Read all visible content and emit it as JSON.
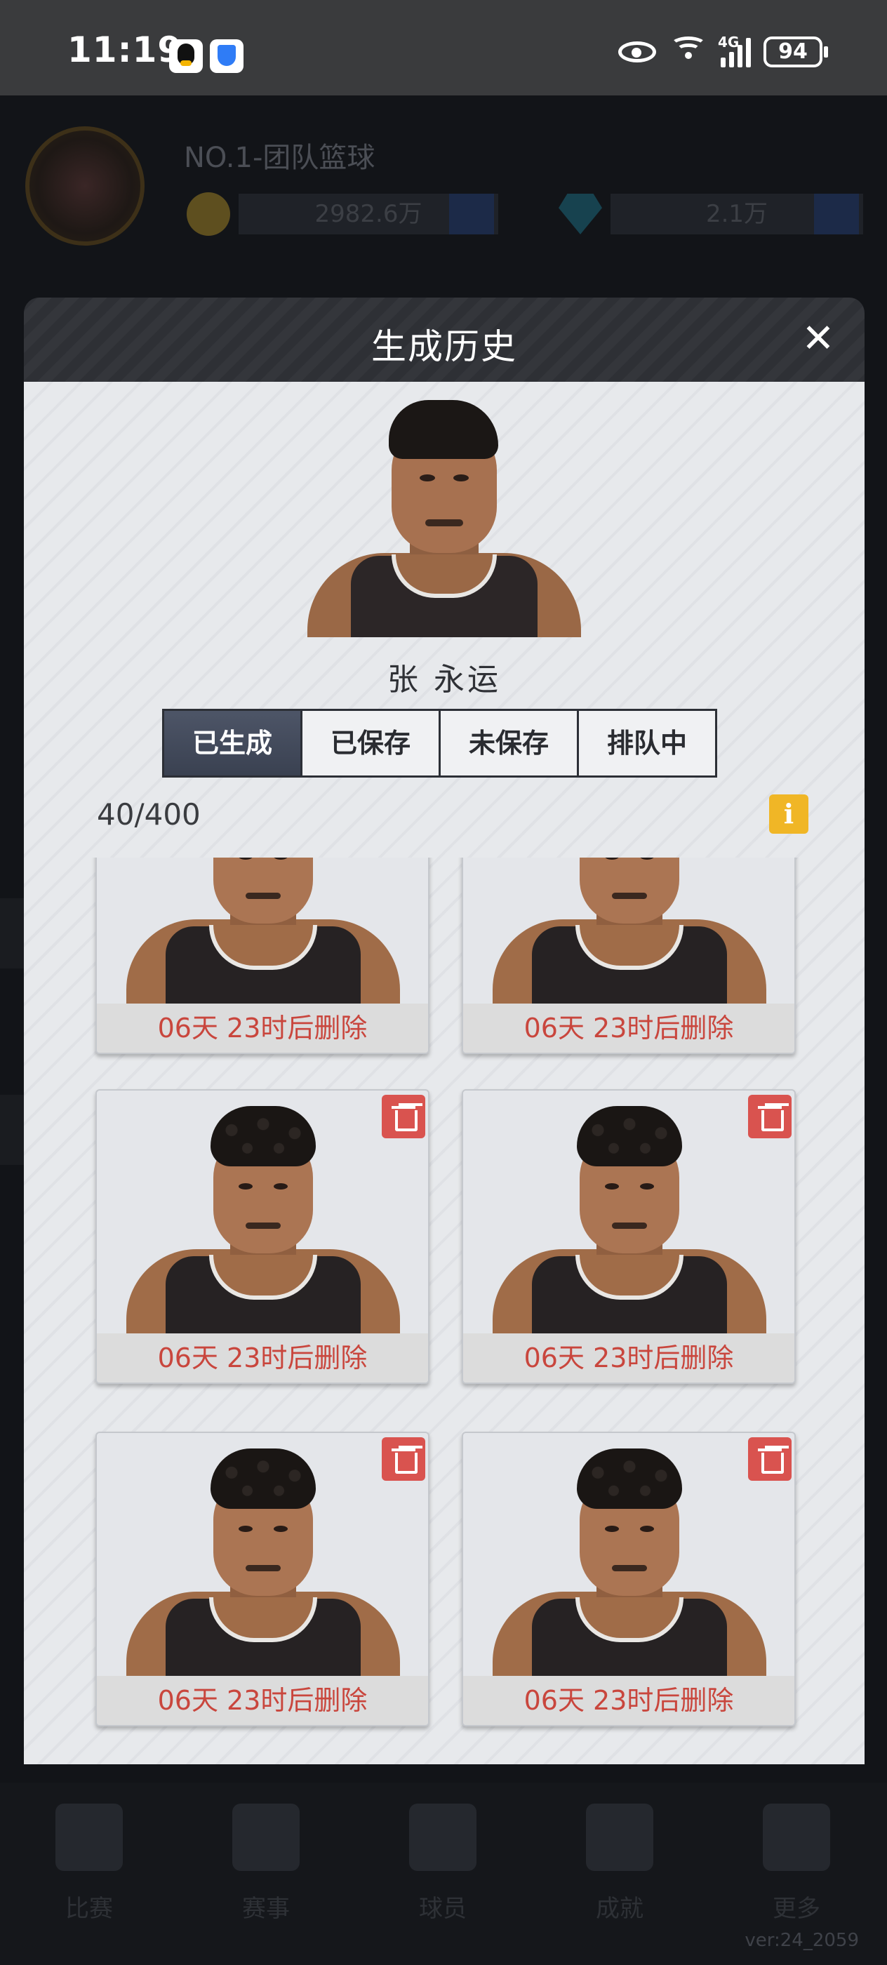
{
  "status_bar": {
    "time": "11:19",
    "battery": "94",
    "network": "4G",
    "icons": [
      "qq-icon",
      "shield-icon",
      "eye-icon",
      "wifi-icon",
      "signal-icon",
      "battery-icon"
    ]
  },
  "background": {
    "team_name": "NO.1-团队篮球",
    "coins": "2982.6万",
    "gems": "2.1万",
    "nav": [
      "比赛",
      "赛事",
      "球员",
      "成就",
      "更多"
    ],
    "version": "ver:24_2059"
  },
  "modal": {
    "title": "生成历史",
    "close_icon": "close-icon",
    "player_name": "张 永运",
    "tabs": [
      {
        "label": "已生成",
        "active": true
      },
      {
        "label": "已保存",
        "active": false
      },
      {
        "label": "未保存",
        "active": false
      },
      {
        "label": "排队中",
        "active": false
      }
    ],
    "count": "40/400",
    "info_label": "i",
    "cards": [
      {
        "label": "06天 23时后删除",
        "has_delete": false,
        "hair": "short"
      },
      {
        "label": "06天 23时后删除",
        "has_delete": false,
        "hair": "short"
      },
      {
        "label": "06天 23时后删除",
        "has_delete": true,
        "hair": "curly"
      },
      {
        "label": "06天 23时后删除",
        "has_delete": true,
        "hair": "curly"
      },
      {
        "label": "06天 23时后删除",
        "has_delete": true,
        "hair": "curly"
      },
      {
        "label": "06天 23时后删除",
        "has_delete": true,
        "hair": "curly"
      }
    ]
  },
  "colors": {
    "active_tab": "#3f4656",
    "delete_red": "#d9534f",
    "countdown_red": "#c9463d",
    "info_yellow": "#f0b626"
  }
}
